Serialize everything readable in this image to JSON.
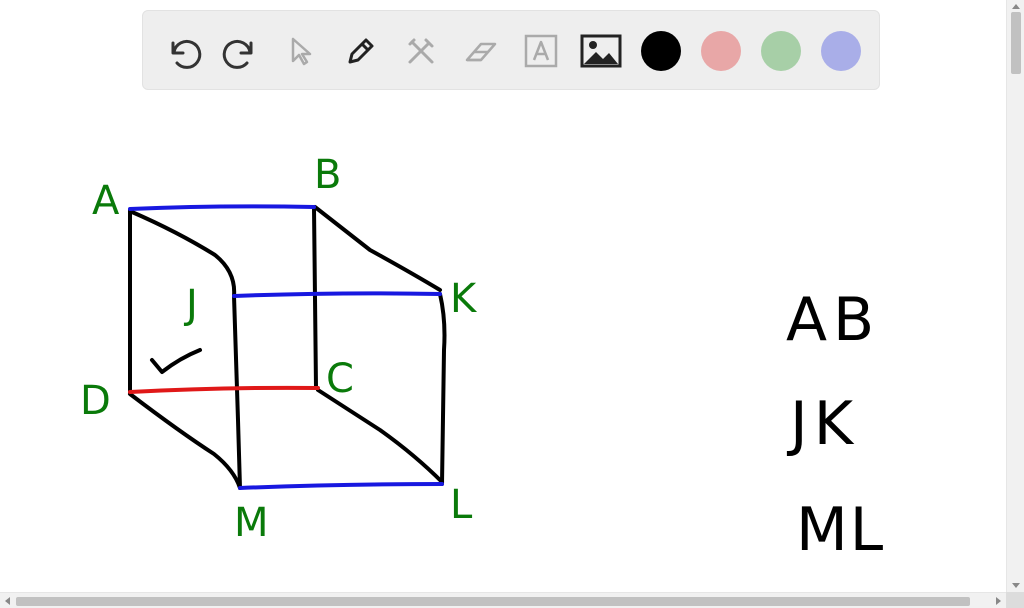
{
  "toolbar": {
    "tools": [
      "undo-icon",
      "redo-icon",
      "select-icon",
      "pen-icon",
      "tools-icon",
      "eraser-icon",
      "text-icon",
      "image-icon"
    ],
    "colors": [
      "#000000",
      "#e8a7a7",
      "#a7cfa7",
      "#a9aee8"
    ]
  },
  "drawing": {
    "vertices": {
      "A": "A",
      "B": "B",
      "J": "J",
      "K": "K",
      "D": "D",
      "C": "C",
      "M": "M",
      "L": "L"
    },
    "pairs": [
      "AB",
      "JK",
      "ML"
    ],
    "label_color": "#0a7a0a",
    "edge_colors": {
      "parallel": "#1818e0",
      "highlight": "#e01818",
      "other": "#000000"
    }
  }
}
